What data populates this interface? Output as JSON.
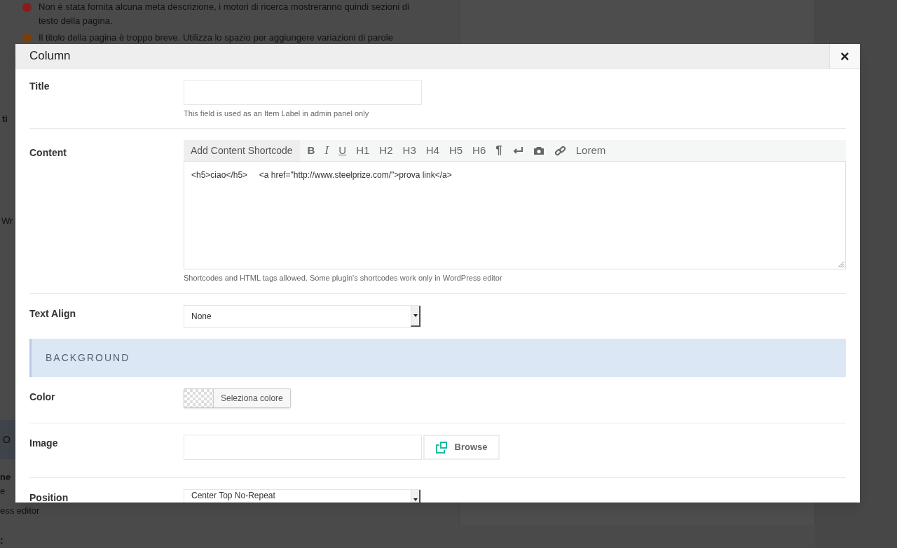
{
  "background_page": {
    "notices": [
      {
        "text": "Non è stata fornita alcuna meta descrizione, i motori di ricerca mostreranno quindi sezioni di testo della pagina.",
        "color": "#8a1c1c"
      },
      {
        "text": "Il titolo della pagina è troppo breve. Utilizza lo spazio per aggiungere variazioni di parole",
        "color": "#7a3d0c"
      }
    ],
    "fragments": [
      "ti",
      "Wr",
      "O",
      "ne",
      "e",
      "ess editor",
      ":"
    ]
  },
  "modal": {
    "title": "Column",
    "close": "×",
    "title_field": {
      "label": "Title",
      "help": "This field is used as an Item Label in admin panel only"
    },
    "content_field": {
      "label": "Content",
      "shortcode_button": "Add Content Shortcode",
      "toolbar": [
        {
          "kind": "bold",
          "label": "B"
        },
        {
          "kind": "italic",
          "label": "I"
        },
        {
          "kind": "underline",
          "label": "U"
        },
        {
          "kind": "text",
          "label": "H1"
        },
        {
          "kind": "text",
          "label": "H2"
        },
        {
          "kind": "text",
          "label": "H3"
        },
        {
          "kind": "text",
          "label": "H4"
        },
        {
          "kind": "text",
          "label": "H5"
        },
        {
          "kind": "text",
          "label": "H6"
        },
        {
          "kind": "pilcrow",
          "label": "¶"
        },
        {
          "kind": "enter"
        },
        {
          "kind": "camera"
        },
        {
          "kind": "link"
        },
        {
          "kind": "text",
          "label": "Lorem"
        }
      ],
      "value": "<h5>ciao</h5>     <a href=\"http://www.steelprize.com/\">prova link</a>",
      "help": "Shortcodes and HTML tags allowed. Some plugin's shortcodes work only in WordPress editor"
    },
    "text_align": {
      "label": "Text Align",
      "value": "None"
    },
    "section": "BACKGROUND",
    "color_field": {
      "label": "Color",
      "button": "Seleziona colore"
    },
    "image_field": {
      "label": "Image",
      "button": "Browse"
    },
    "position_field": {
      "label": "Position",
      "value": "Center Top No-Repeat"
    }
  }
}
